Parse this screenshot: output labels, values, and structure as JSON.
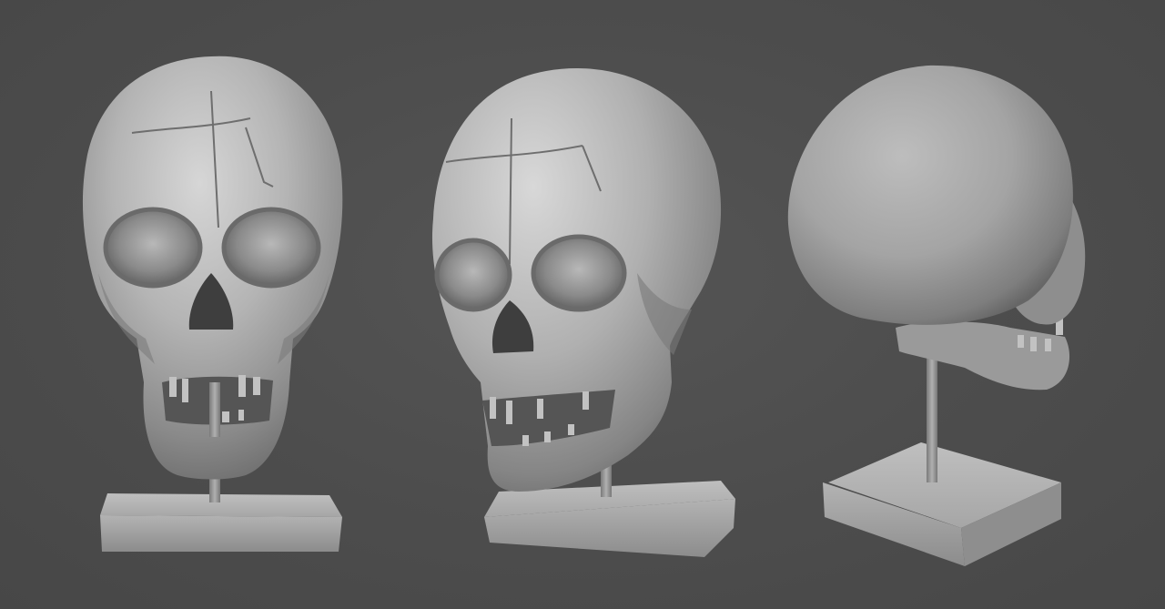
{
  "scene": {
    "background_color": "#4d4d4d",
    "model_color": "#a8a8a8",
    "views": [
      {
        "id": "front",
        "label": "skull-front-view"
      },
      {
        "id": "three-quarter",
        "label": "skull-three-quarter-view"
      },
      {
        "id": "rear",
        "label": "skull-rear-three-quarter-view"
      }
    ]
  }
}
